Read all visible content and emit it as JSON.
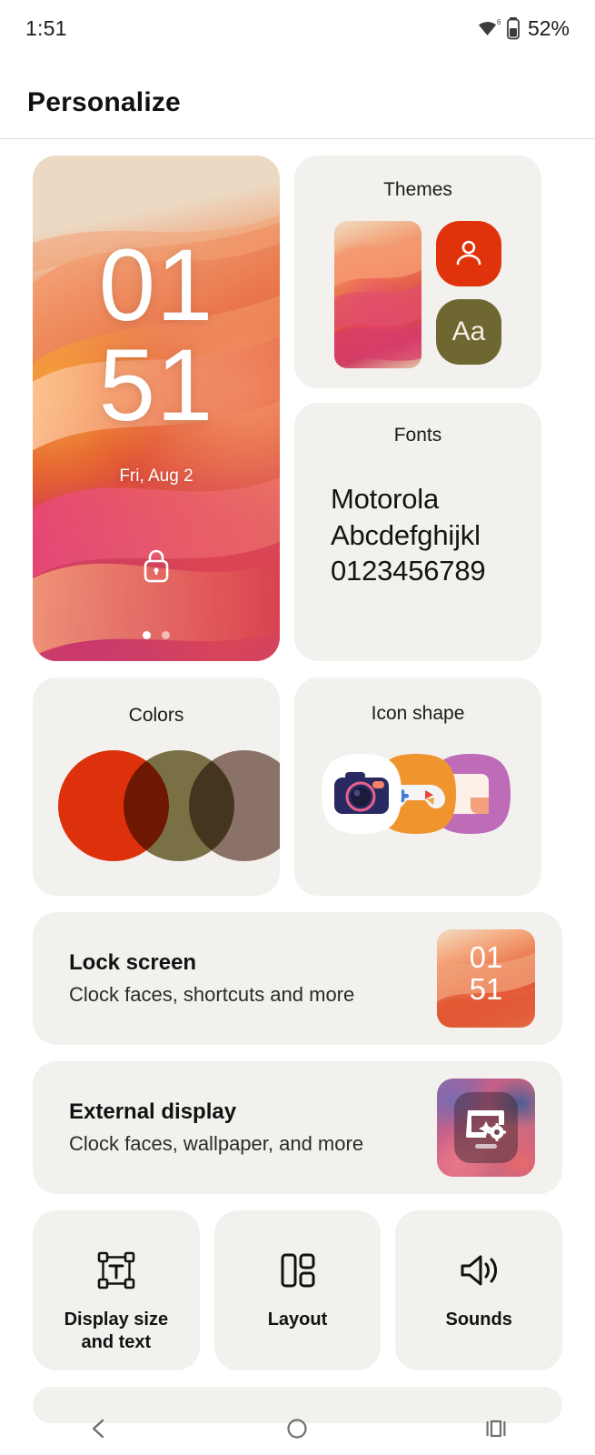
{
  "status_bar": {
    "time": "1:51",
    "battery_percent": "52%",
    "wifi_icon": "wifi-6-icon",
    "battery_icon": "battery-icon"
  },
  "header": {
    "title": "Personalize"
  },
  "wallpaper_preview": {
    "name": "wallpaper-preview",
    "clock_hours": "01",
    "clock_minutes": "51",
    "date": "Fri, Aug 2",
    "lock_icon": "lock-icon",
    "page_dots": 2,
    "active_dot": 1
  },
  "themes": {
    "title": "Themes",
    "wallpaper_swatch": "theme-wallpaper-swatch",
    "person_icon": "person-icon",
    "font_tile_label": "Aa",
    "accent_color": "#e0330c",
    "font_tile_color": "#6f6732"
  },
  "fonts": {
    "title": "Fonts",
    "sample_lines": [
      "Motorola",
      "Abcdefghijkl",
      "0123456789"
    ]
  },
  "colors": {
    "title": "Colors",
    "swatches": [
      "#e8330a",
      "#80764a",
      "#93796f"
    ]
  },
  "icon_shape": {
    "title": "Icon shape",
    "icons": [
      "camera-app-icon",
      "games-app-icon",
      "files-app-icon"
    ]
  },
  "lock_screen": {
    "title": "Lock screen",
    "subtitle": "Clock faces, shortcuts and more",
    "thumb_hours": "01",
    "thumb_minutes": "51"
  },
  "external_display": {
    "title": "External display",
    "subtitle": "Clock faces, wallpaper, and more",
    "icon": "external-display-icon"
  },
  "tiles": [
    {
      "label": "Display size\nand text",
      "icon": "display-size-text-icon"
    },
    {
      "label": "Layout",
      "icon": "layout-icon"
    },
    {
      "label": "Sounds",
      "icon": "sounds-icon"
    }
  ],
  "tile_labels": {
    "display_size": "Display size and text",
    "layout": "Layout",
    "sounds": "Sounds"
  },
  "nav_bar": {
    "back": "back-icon",
    "home": "home-icon",
    "recents": "recents-icon"
  }
}
